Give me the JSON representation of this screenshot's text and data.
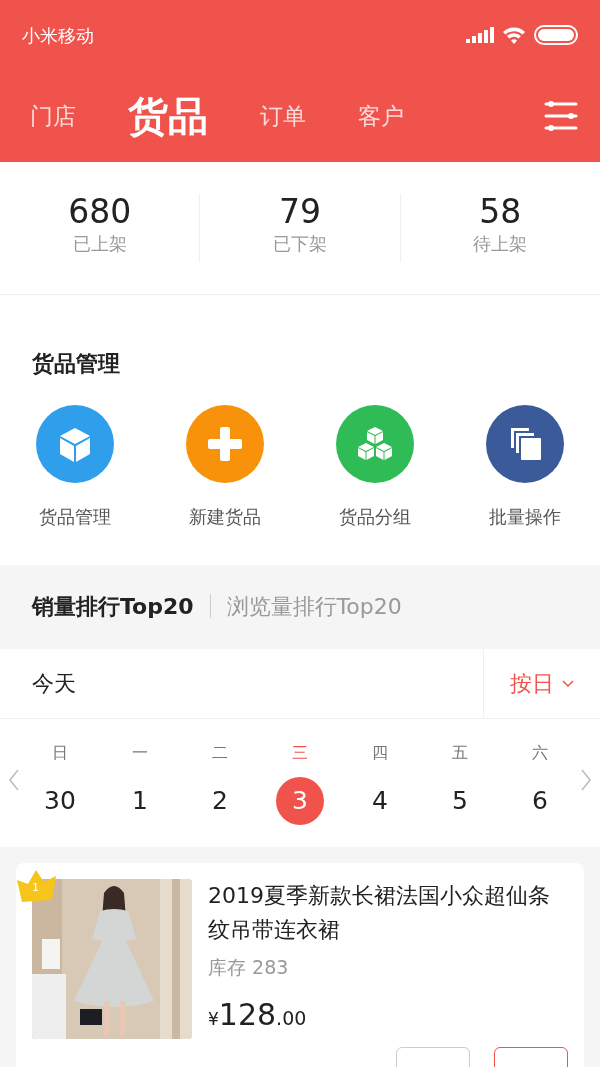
{
  "status_bar": {
    "carrier": "小米移动"
  },
  "tabs": [
    {
      "label": "门店",
      "selected": false
    },
    {
      "label": "货品",
      "selected": true
    },
    {
      "label": "订单",
      "selected": false
    },
    {
      "label": "客户",
      "selected": false
    }
  ],
  "stats": [
    {
      "value": "680",
      "label": "已上架"
    },
    {
      "value": "79",
      "label": "已下架"
    },
    {
      "value": "58",
      "label": "待上架"
    }
  ],
  "management": {
    "title": "货品管理",
    "items": [
      {
        "label": "货品管理",
        "kind": "cube",
        "color": "#2f9fec"
      },
      {
        "label": "新建货品",
        "kind": "plus",
        "color": "#f7920a"
      },
      {
        "label": "货品分组",
        "kind": "cubes",
        "color": "#2fbb55"
      },
      {
        "label": "批量操作",
        "kind": "stack",
        "color": "#3b5a9a"
      }
    ]
  },
  "ranking_tabs": [
    {
      "label": "销量排行Top20",
      "selected": true
    },
    {
      "label": "浏览量排行Top20",
      "selected": false
    }
  ],
  "period": {
    "label": "今天",
    "mode": "按日"
  },
  "calendar": [
    {
      "weekday": "日",
      "date": "30",
      "selected": false
    },
    {
      "weekday": "一",
      "date": "1",
      "selected": false
    },
    {
      "weekday": "二",
      "date": "2",
      "selected": false
    },
    {
      "weekday": "三",
      "date": "3",
      "selected": true
    },
    {
      "weekday": "四",
      "date": "4",
      "selected": false
    },
    {
      "weekday": "五",
      "date": "5",
      "selected": false
    },
    {
      "weekday": "六",
      "date": "6",
      "selected": false
    }
  ],
  "products": [
    {
      "rank": "1",
      "title": "2019夏季新款长裙法国小众超仙条纹吊带连衣裙",
      "stock": "库存 283",
      "currency": "¥",
      "price_main": "128",
      "price_cents": ".00"
    }
  ]
}
